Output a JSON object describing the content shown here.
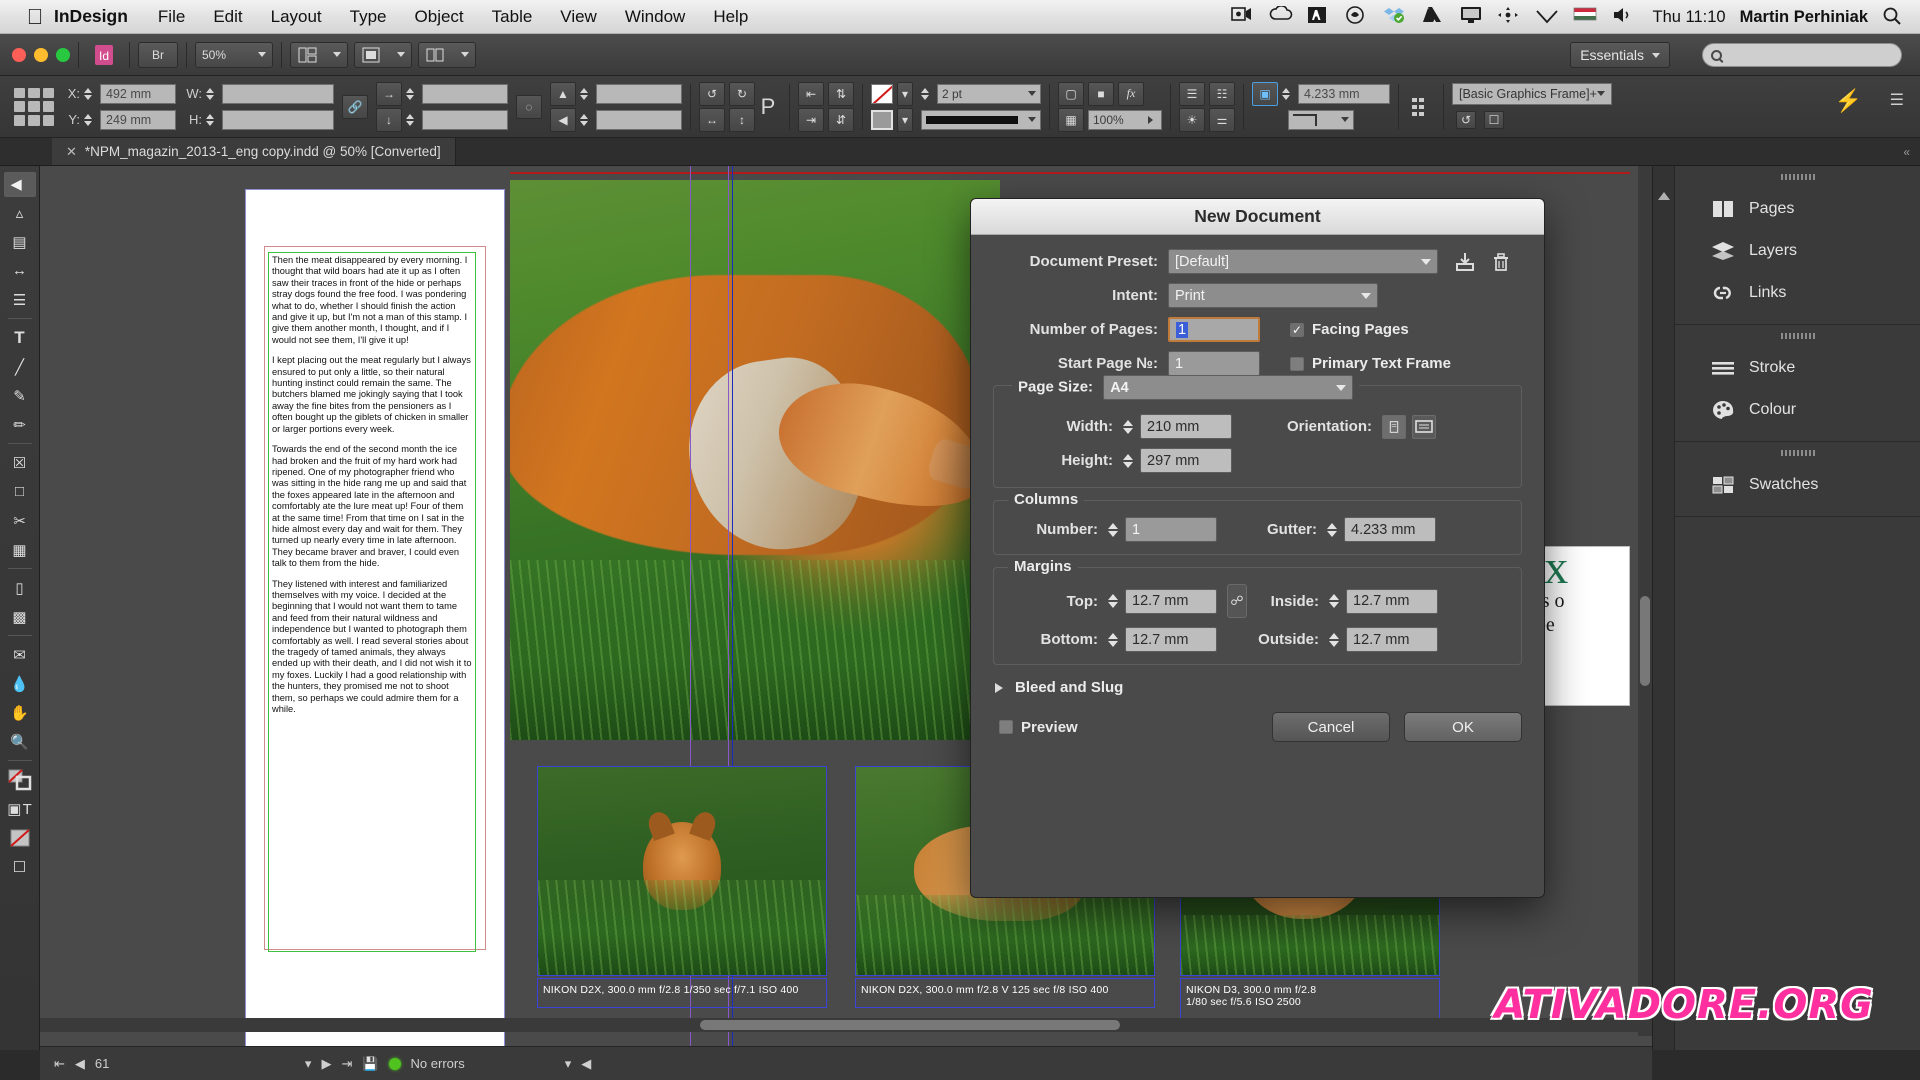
{
  "menubar": {
    "apple_icon": "apple-logo",
    "app_name": "InDesign",
    "items": [
      "File",
      "Edit",
      "Layout",
      "Type",
      "Object",
      "Table",
      "View",
      "Window",
      "Help"
    ],
    "status_icons": [
      "screen-recorder-icon",
      "cloud-icon",
      "adobe-icon",
      "hazel-icon",
      "dropbox-icon",
      "google-drive-icon",
      "display-icon",
      "airdrop-icon",
      "wifi-icon",
      "hungary-flag-icon",
      "volume-icon"
    ],
    "clock": "Thu 11:10",
    "user": "Martin Perhiniak",
    "search_icon": "search-icon"
  },
  "titlebar": {
    "bridge_label": "Br",
    "zoom_level": "50%",
    "view_icons": [
      "view-options-icon",
      "screen-mode-icon",
      "arrange-documents-icon"
    ],
    "workspace": "Essentials",
    "search_placeholder": ""
  },
  "control_bar": {
    "x_label": "X:",
    "x_value": "492 mm",
    "y_label": "Y:",
    "y_value": "249 mm",
    "w_label": "W:",
    "w_value": "",
    "h_label": "H:",
    "h_value": "",
    "stroke_weight": "2 pt",
    "stroke_type": "solid-line",
    "opacity": "100%",
    "gutter_or_offset": "4.233 mm",
    "object_style": "[Basic Graphics Frame]+",
    "fx_label": "fx",
    "p_label": "P"
  },
  "document_tab": {
    "close_icon": "close-icon",
    "title": "*NPM_magazin_2013-1_eng copy.indd @ 50% [Converted]"
  },
  "toolbar": {
    "tools": [
      "selection-tool",
      "direct-selection-tool",
      "page-tool",
      "gap-tool",
      "content-collector-tool",
      "type-tool",
      "line-tool",
      "pen-tool",
      "pencil-tool",
      "frame-tool",
      "rectangle-tool",
      "scissors-tool",
      "free-transform-tool",
      "gradient-swatch-tool",
      "gradient-feather-tool",
      "note-tool",
      "eyedropper-tool",
      "hand-tool",
      "zoom-tool",
      "fill-stroke-swatch",
      "formatting-affects-container",
      "apply-none"
    ]
  },
  "statusbar": {
    "page_number": "61",
    "errors_text": "No errors",
    "first_icon": "first-page-icon",
    "prev_icon": "previous-page-icon",
    "next_icon": "next-page-icon",
    "last_icon": "last-page-icon",
    "save_icon": "save-status-icon",
    "status_color": "#4fc21f"
  },
  "dock": {
    "groups": [
      {
        "items": [
          {
            "label": "Pages",
            "icon": "pages-icon"
          },
          {
            "label": "Layers",
            "icon": "layers-icon"
          },
          {
            "label": "Links",
            "icon": "links-icon"
          }
        ]
      },
      {
        "items": [
          {
            "label": "Stroke",
            "icon": "stroke-icon"
          },
          {
            "label": "Colour",
            "icon": "colour-palette-icon"
          }
        ]
      },
      {
        "items": [
          {
            "label": "Swatches",
            "icon": "swatches-grid-icon"
          }
        ]
      }
    ]
  },
  "dialog": {
    "title": "New Document",
    "preset_label": "Document Preset:",
    "preset_value": "[Default]",
    "save_preset_icon": "save-preset-icon",
    "delete_preset_icon": "trash-icon",
    "intent_label": "Intent:",
    "intent_value": "Print",
    "pages_label": "Number of Pages:",
    "pages_value": "1",
    "facing_pages_label": "Facing Pages",
    "facing_pages_checked": true,
    "start_page_label": "Start Page №:",
    "start_page_value": "1",
    "primary_text_frame_label": "Primary Text Frame",
    "primary_text_frame_checked": false,
    "page_size_label": "Page Size:",
    "page_size_value": "A4",
    "width_label": "Width:",
    "width_value": "210 mm",
    "height_label": "Height:",
    "height_value": "297 mm",
    "orientation_label": "Orientation:",
    "orientation_portrait_icon": "portrait-icon",
    "orientation_landscape_icon": "landscape-icon",
    "columns_legend": "Columns",
    "columns_number_label": "Number:",
    "columns_number_value": "1",
    "gutter_label": "Gutter:",
    "gutter_value": "4.233 mm",
    "margins_legend": "Margins",
    "margin_top_label": "Top:",
    "margin_top_value": "12.7 mm",
    "margin_bottom_label": "Bottom:",
    "margin_bottom_value": "12.7 mm",
    "margin_inside_label": "Inside:",
    "margin_inside_value": "12.7 mm",
    "margin_outside_label": "Outside:",
    "margin_outside_value": "12.7 mm",
    "link_margins_icon": "chain-link-icon",
    "bleed_slug_label": "Bleed and Slug",
    "preview_label": "Preview",
    "preview_checked": false,
    "cancel_label": "Cancel",
    "ok_label": "OK"
  },
  "document": {
    "body_paragraphs": [
      "Then the meat disappeared by every morning. I thought that wild boars had ate it up as I often saw their traces in front of the hide or perhaps stray dogs found the free food. I was pondering what to do, whether I should finish the action and give it up, but I'm not a man of this stamp. I give them another month, I thought, and if I would not see them, I'll give it up!",
      "I kept placing out the meat regularly but I always ensured to put only a little, so their natural hunting instinct could remain the same. The butchers blamed me jokingly saying that I took away the fine bites from the pensioners as I often bought up the giblets of chicken in smaller or larger portions every week.",
      "Towards the end of the second month the ice had broken and the fruit of my hard work had ripened. One of my photographer friend who was sitting in the hide rang me up and said that the foxes appeared late in the afternoon and comfortably ate the lure meat up! Four of them at the same time! From that time on I sat in the hide almost every day and wait for them. They turned up nearly every time in late afternoon. They became braver and braver, I could even talk to them from the hide.",
      "They listened with interest and familiarized themselves with my voice. I decided at the beginning that I would not want them to tame and feed from their natural wildness and independence but I wanted to photograph them comfortably as well. I read several stories about the tragedy of tamed animals, they always ended up with their death, and I did not wish it to my foxes. Luckily I had a good relationship with the hunters, they promised me not to shoot them, so perhaps we could admire them for a while."
    ],
    "captions": [
      "NIKON D2X, 300.0 mm f/2.8    1/350 sec  f/7.1  ISO 400",
      "NIKON D2X, 300.0 mm f/2.8    V 125 sec  f/8  ISO 400",
      "NIKON D3, 300.0 mm f/2.8\n1/80 sec  f/5.6  ISO 2500"
    ],
    "snippet_big": "ex",
    "snippet_line2": "it's o",
    "snippet_line3": "kee"
  },
  "watermark": {
    "text": "ATIVADORE.ORG",
    "color": "#ff2fa0"
  }
}
